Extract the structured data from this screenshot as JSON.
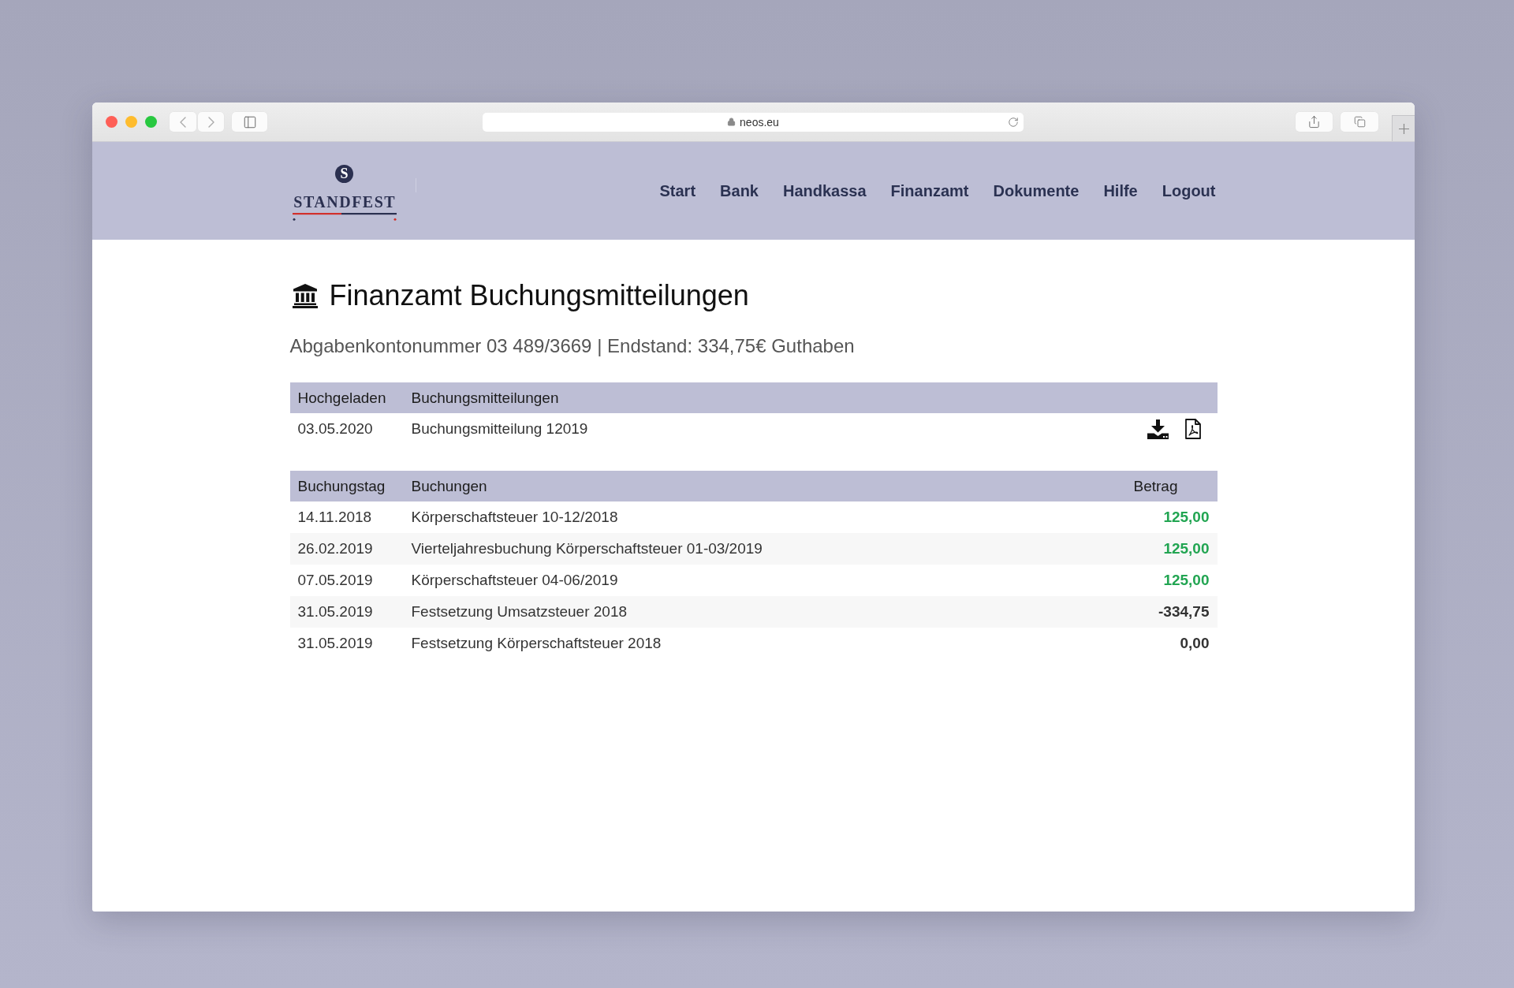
{
  "browser": {
    "url": "neos.eu"
  },
  "header": {
    "logo": {
      "monogram": "S",
      "wordmark": "STANDFEST"
    },
    "nav": [
      "Start",
      "Bank",
      "Handkassa",
      "Finanzamt",
      "Dokumente",
      "Hilfe",
      "Logout"
    ]
  },
  "page": {
    "title": "Finanzamt Buchungsmitteilungen",
    "subtitle": "Abgabenkontonummer 03 489/3669 | Endstand: 334,75€ Guthaben"
  },
  "documents": {
    "columns": [
      "Hochgeladen",
      "Buchungsmitteilungen"
    ],
    "rows": [
      {
        "date": "03.05.2020",
        "title": "Buchungsmitteilung 12019"
      }
    ]
  },
  "bookings": {
    "columns": [
      "Buchungstag",
      "Buchungen",
      "Betrag"
    ],
    "rows": [
      {
        "date": "14.11.2018",
        "text": "Körperschaftsteuer 10-12/2018",
        "amount": "125,00",
        "credit": true
      },
      {
        "date": "26.02.2019",
        "text": "Vierteljahresbuchung Körperschaftsteuer 01-03/2019",
        "amount": "125,00",
        "credit": true
      },
      {
        "date": "07.05.2019",
        "text": "Körperschaftsteuer 04-06/2019",
        "amount": "125,00",
        "credit": true
      },
      {
        "date": "31.05.2019",
        "text": "Festsetzung Umsatzsteuer 2018",
        "amount": "-334,75",
        "credit": false
      },
      {
        "date": "31.05.2019",
        "text": "Festsetzung Körperschaftsteuer 2018",
        "amount": "0,00",
        "credit": false
      }
    ]
  }
}
